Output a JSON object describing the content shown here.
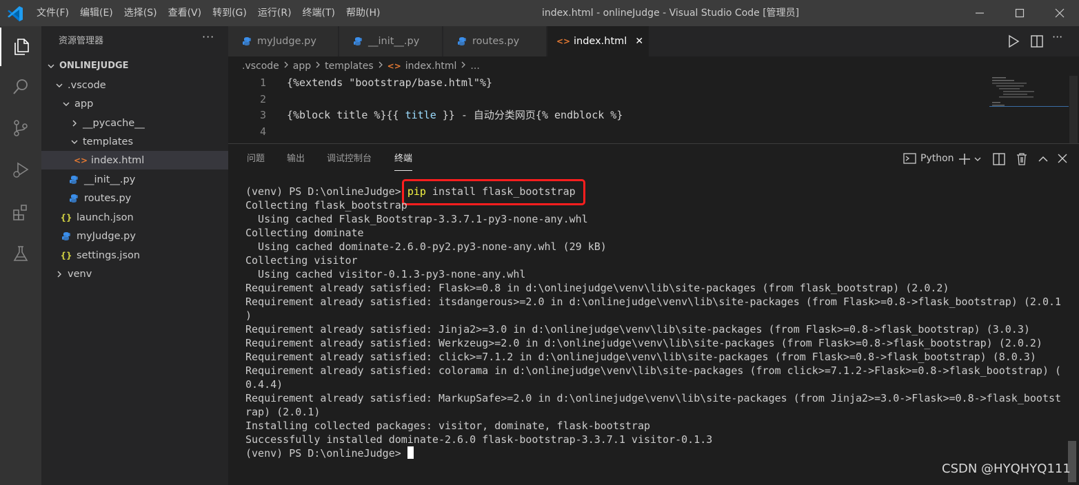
{
  "window": {
    "title": "index.html - onlineJudge - Visual Studio Code [管理员]",
    "menu": [
      "文件(F)",
      "编辑(E)",
      "选择(S)",
      "查看(V)",
      "转到(G)",
      "运行(R)",
      "终端(T)",
      "帮助(H)"
    ]
  },
  "activity_bar": [
    "explorer-icon",
    "search-icon",
    "source-control-icon",
    "run-debug-icon",
    "extensions-icon",
    "testing-icon"
  ],
  "sidebar": {
    "title": "资源管理器",
    "more": "···",
    "tree": [
      {
        "label": "ONLINEJUDGE",
        "kind": "root",
        "expanded": true
      },
      {
        "label": ".vscode",
        "kind": "folder",
        "expanded": true
      },
      {
        "label": "app",
        "kind": "folder",
        "expanded": true
      },
      {
        "label": "__pycache__",
        "kind": "folder",
        "expanded": false
      },
      {
        "label": "templates",
        "kind": "folder",
        "expanded": true
      },
      {
        "label": "index.html",
        "kind": "html",
        "selected": true
      },
      {
        "label": "__init__.py",
        "kind": "python"
      },
      {
        "label": "routes.py",
        "kind": "python"
      },
      {
        "label": "launch.json",
        "kind": "json"
      },
      {
        "label": "myJudge.py",
        "kind": "python"
      },
      {
        "label": "settings.json",
        "kind": "json"
      },
      {
        "label": "venv",
        "kind": "folder",
        "expanded": false
      }
    ]
  },
  "tabs": [
    {
      "label": "myJudge.py",
      "kind": "python"
    },
    {
      "label": "__init__.py",
      "kind": "python"
    },
    {
      "label": "routes.py",
      "kind": "python"
    },
    {
      "label": "index.html",
      "kind": "html",
      "active": true,
      "close": "✕"
    }
  ],
  "breadcrumb": [
    ".vscode",
    "app",
    "templates",
    "index.html",
    "..."
  ],
  "editor": {
    "lines": [
      {
        "n": "1",
        "code": "{%extends \"bootstrap/base.html\"%}"
      },
      {
        "n": "2",
        "code": ""
      },
      {
        "n": "3",
        "code_parts": [
          "{%block title %}{{ ",
          "title",
          " }} - 自动分类网页{% endblock %}"
        ]
      },
      {
        "n": "4",
        "code": ""
      }
    ]
  },
  "panel": {
    "tabs": [
      "问题",
      "输出",
      "调试控制台",
      "终端"
    ],
    "active_tab": "终端",
    "shell": "Python"
  },
  "terminal": {
    "prompt": "(venv) PS D:\\onlineJudge>",
    "command_keyword": "pip",
    "command_rest": " install flask_bootstrap",
    "output": [
      "Collecting flask_bootstrap",
      "  Using cached Flask_Bootstrap-3.3.7.1-py3-none-any.whl",
      "Collecting dominate",
      "  Using cached dominate-2.6.0-py2.py3-none-any.whl (29 kB)",
      "Collecting visitor",
      "  Using cached visitor-0.1.3-py3-none-any.whl",
      "Requirement already satisfied: Flask>=0.8 in d:\\onlinejudge\\venv\\lib\\site-packages (from flask_bootstrap) (2.0.2)",
      "Requirement already satisfied: itsdangerous>=2.0 in d:\\onlinejudge\\venv\\lib\\site-packages (from Flask>=0.8->flask_bootstrap) (2.0.1",
      ")",
      "Requirement already satisfied: Jinja2>=3.0 in d:\\onlinejudge\\venv\\lib\\site-packages (from Flask>=0.8->flask_bootstrap) (3.0.3)",
      "Requirement already satisfied: Werkzeug>=2.0 in d:\\onlinejudge\\venv\\lib\\site-packages (from Flask>=0.8->flask_bootstrap) (2.0.2)",
      "Requirement already satisfied: click>=7.1.2 in d:\\onlinejudge\\venv\\lib\\site-packages (from Flask>=0.8->flask_bootstrap) (8.0.3)",
      "Requirement already satisfied: colorama in d:\\onlinejudge\\venv\\lib\\site-packages (from click>=7.1.2->Flask>=0.8->flask_bootstrap) (",
      "0.4.4)",
      "Requirement already satisfied: MarkupSafe>=2.0 in d:\\onlinejudge\\venv\\lib\\site-packages (from Jinja2>=3.0->Flask>=0.8->flask_bootst",
      "rap) (2.0.1)",
      "Installing collected packages: visitor, dominate, flask-bootstrap",
      "Successfully installed dominate-2.6.0 flask-bootstrap-3.3.7.1 visitor-0.1.3"
    ],
    "final_prompt": "(venv) PS D:\\onlineJudge>"
  },
  "watermark": "CSDN @HYQHYQ111",
  "colors": {
    "titlebar": "#3c3c3c",
    "activitybar": "#333333",
    "sidebar": "#252526",
    "editor": "#1e1e1e",
    "highlight": "#ff1e1e",
    "python_icon": "#3b8eea",
    "html_icon": "#e37933",
    "json_icon": "#cbcb41"
  }
}
